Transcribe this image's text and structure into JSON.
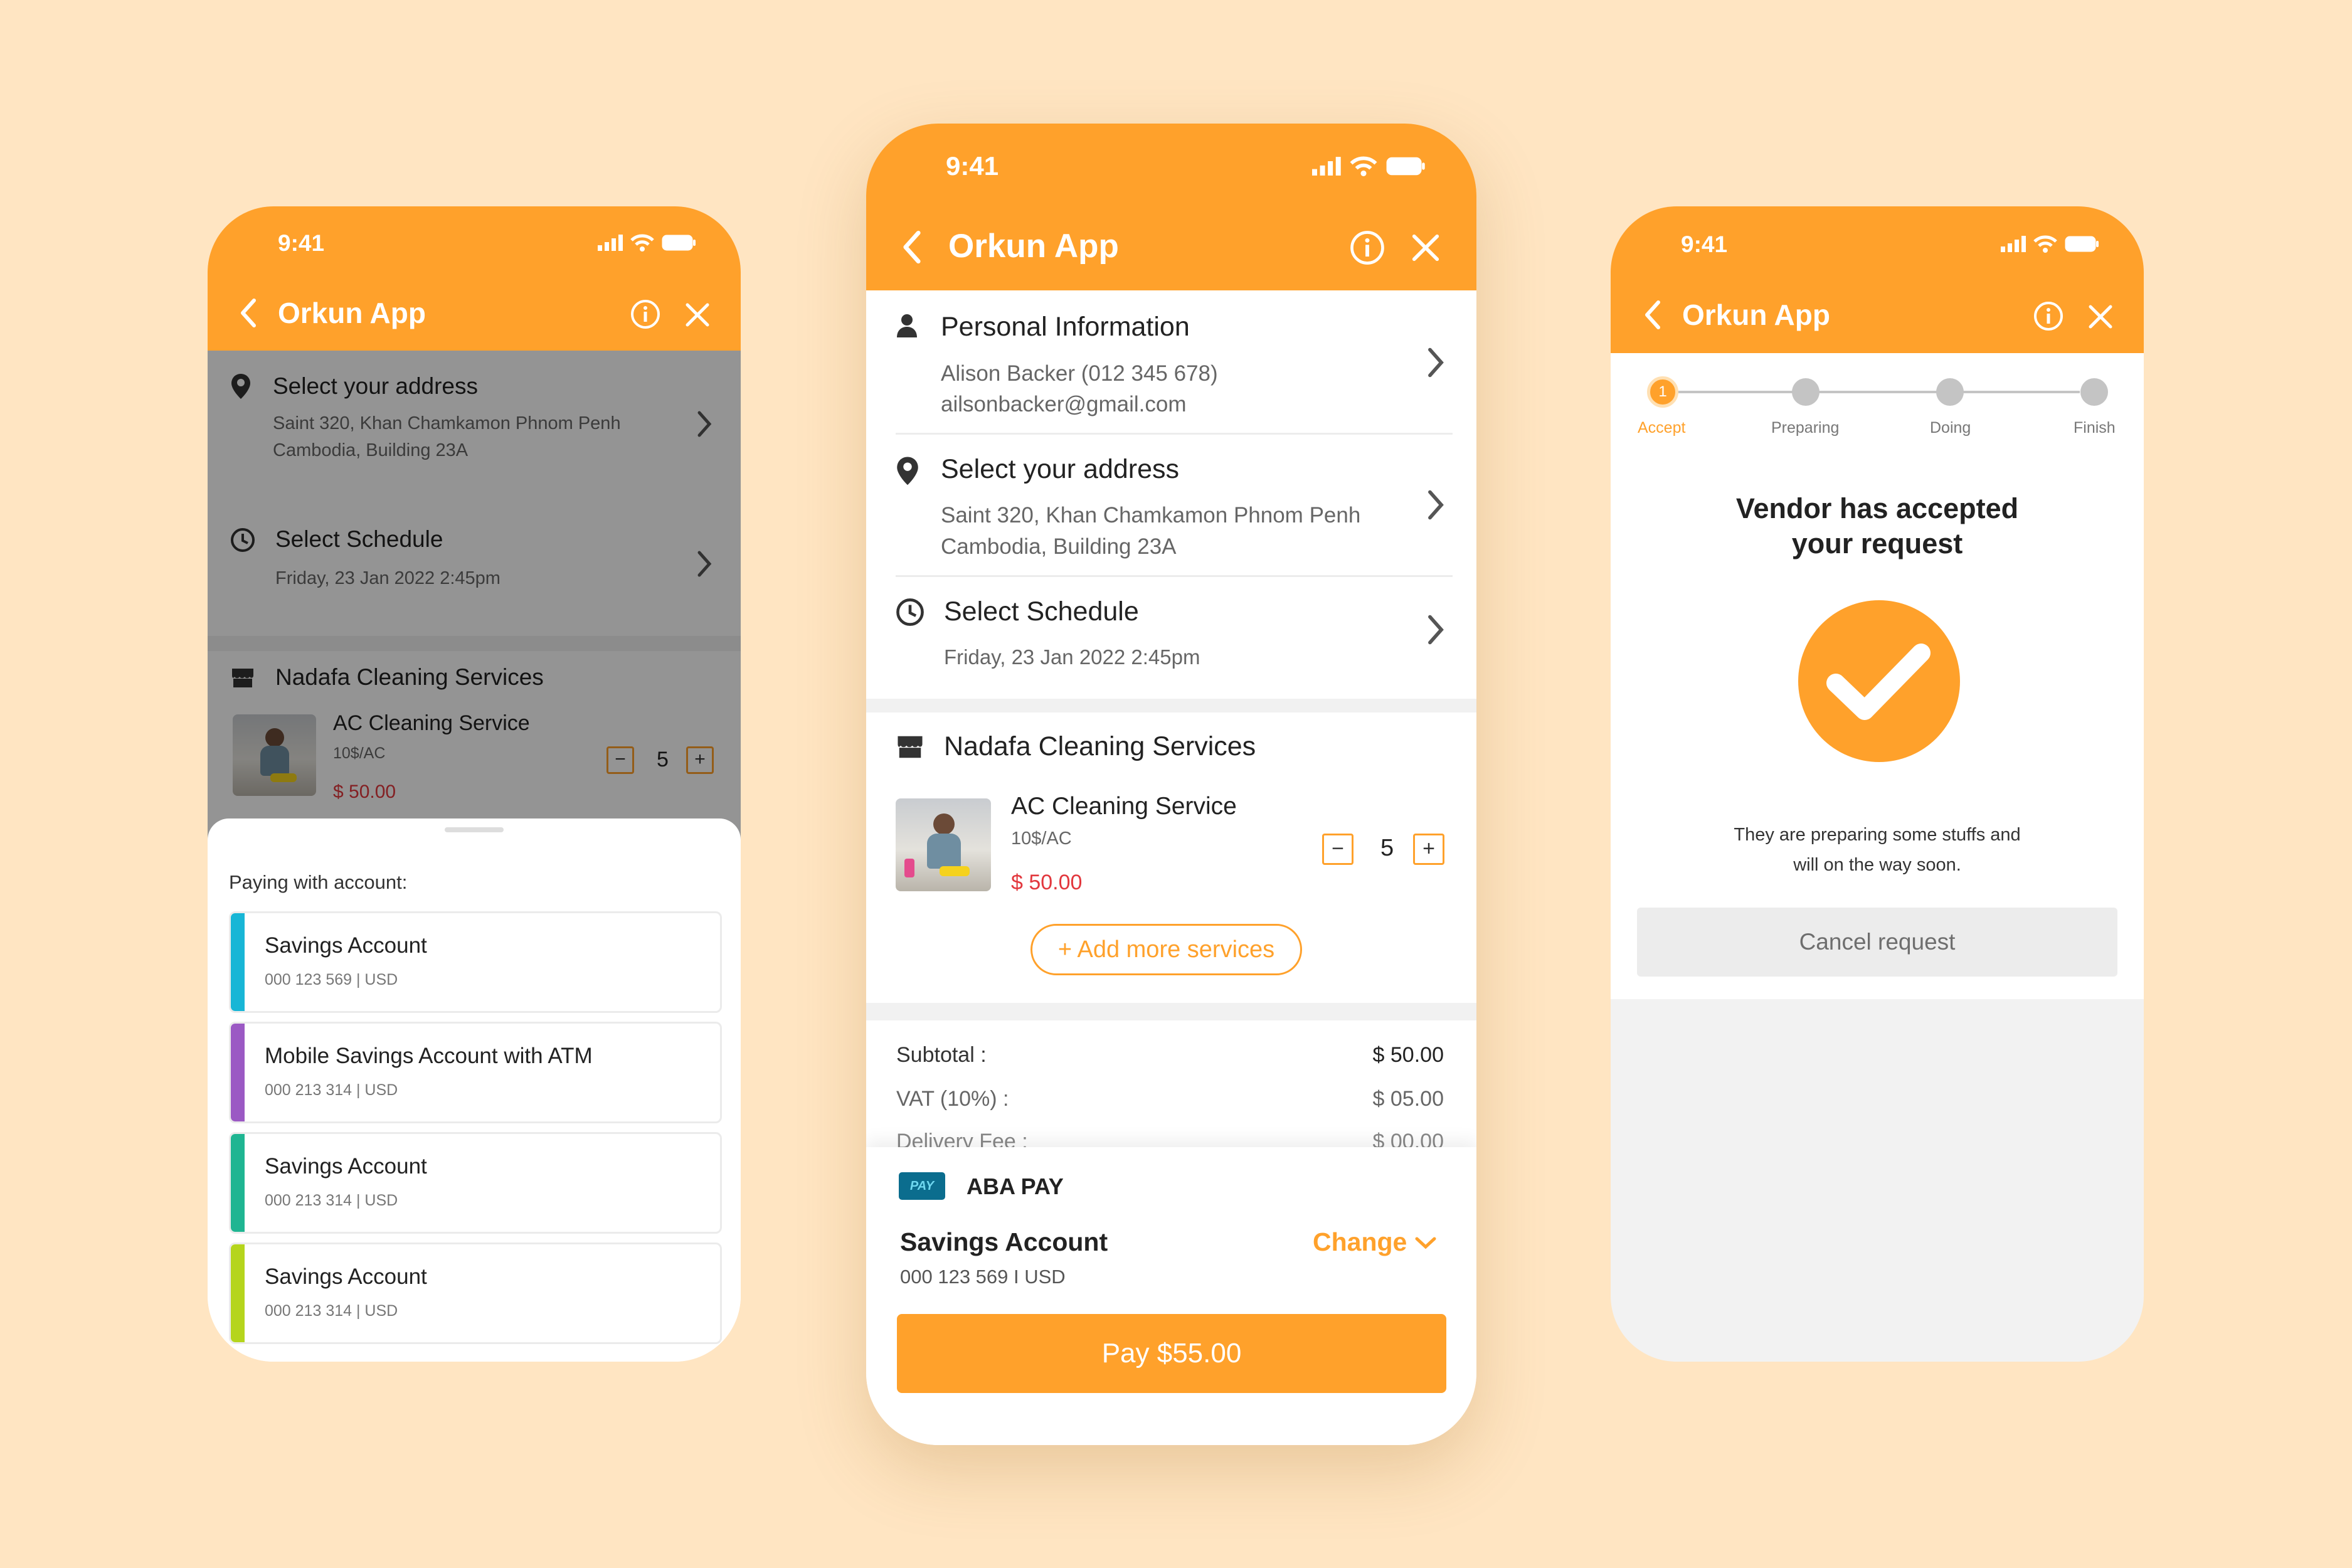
{
  "app": {
    "time": "9:41",
    "title": "Orkun App",
    "icons": {
      "back": "chevron-left-icon",
      "info": "info-circle-icon",
      "close": "close-icon",
      "signal": "signal-icon",
      "wifi": "wifi-icon",
      "battery": "battery-icon"
    }
  },
  "colors": {
    "accent": "#ffa12b",
    "price": "#e2373d",
    "background": "#ffe5c2"
  },
  "checkout": {
    "personal": {
      "title": "Personal Information",
      "line1": "Alison Backer (012 345 678)",
      "line2": "ailsonbacker@gmail.com"
    },
    "address": {
      "title": "Select your address",
      "line1": "Saint 320, Khan Chamkamon Phnom Penh",
      "line2": "Cambodia, Building 23A"
    },
    "schedule": {
      "title": "Select Schedule",
      "value": "Friday, 23 Jan 2022 2:45pm"
    },
    "vendor": "Nadafa Cleaning Services",
    "service": {
      "name": "AC Cleaning Service",
      "unit": "10$/AC",
      "price": "$ 50.00",
      "qty": "5",
      "minus": "−",
      "plus": "+"
    },
    "add_more": "+ Add more services",
    "summary": [
      {
        "label": "Subtotal :",
        "value": "$ 50.00"
      },
      {
        "label": "VAT (10%) :",
        "value": "$ 05.00"
      },
      {
        "label": "Delivery Fee :",
        "value": "$ 00.00"
      }
    ],
    "payment": {
      "provider": "ABA PAY",
      "logo_text": "PAY",
      "account": "Savings Account",
      "number": "000 123 569 I USD",
      "change": "Change",
      "pay_button": "Pay $55.00"
    }
  },
  "account_sheet": {
    "address": {
      "title": "Select your address",
      "line1": "Saint 320, Khan Chamkamon Phnom Penh",
      "line2": "Cambodia, Building 23A"
    },
    "schedule": {
      "title": "Select Schedule",
      "value": "Friday, 23 Jan 2022 2:45pm"
    },
    "vendor": "Nadafa Cleaning Services",
    "service": {
      "name": "AC Cleaning Service",
      "unit": "10$/AC",
      "price": "$ 50.00",
      "qty": "5",
      "minus": "−",
      "plus": "+"
    },
    "heading": "Paying with account:",
    "accounts": [
      {
        "name": "Savings Account",
        "number": "000 123 569 | USD",
        "color": "#18b6d6"
      },
      {
        "name": "Mobile Savings Account with ATM",
        "number": "000 213 314 | USD",
        "color": "#9b59c4"
      },
      {
        "name": "Savings Account",
        "number": "000 213 314 | USD",
        "color": "#1fb592"
      },
      {
        "name": "Savings Account",
        "number": "000 213 314 | USD",
        "color": "#b5d51c"
      }
    ]
  },
  "status": {
    "steps": [
      {
        "label": "Accept",
        "number": "1",
        "active": true
      },
      {
        "label": "Preparing",
        "active": false
      },
      {
        "label": "Doing",
        "active": false
      },
      {
        "label": "Finish",
        "active": false
      }
    ],
    "headline_line1": "Vendor has accepted",
    "headline_line2": "your request",
    "check_icon": "check-circle-icon",
    "message_line1": "They are preparing some stuffs and",
    "message_line2": "will on the way soon.",
    "cancel_button": "Cancel request"
  }
}
